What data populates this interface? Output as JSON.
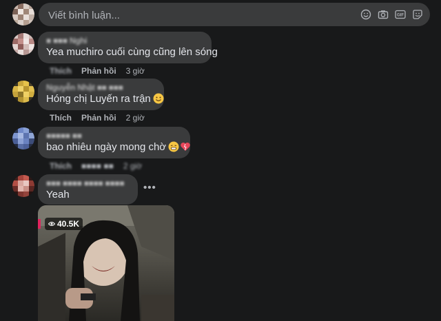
{
  "composer": {
    "placeholder": "Viết bình luận...",
    "icons": [
      "emoji-icon",
      "camera-icon",
      "gif-icon",
      "sticker-icon"
    ]
  },
  "comments": [
    {
      "author": "■ ■■■ Nghi",
      "text": "Yea muchiro cuối cùng cũng lên sóng",
      "like": "Thích",
      "reply": "Phản hồi",
      "time": "3 giờ"
    },
    {
      "author": "Nguyễn Nhật ■■ ■■■",
      "text": "Hóng chị Luyến ra trận",
      "emoji": "smiling-face-emoji",
      "like": "Thích",
      "reply": "Phản hồi",
      "time": "2 giờ"
    },
    {
      "author": "■■■■■ ■■",
      "text": "bao nhiêu ngày mong chờ",
      "emoji": [
        "grinning-face-emoji",
        "heart-emoji"
      ],
      "like": "Thích",
      "reply": "■■■■ ■■",
      "time": "2 giờ"
    },
    {
      "author": "■■■ ■■■■ ■■■■ ■■■■",
      "text": "Yeah",
      "more": "•••",
      "video": {
        "views": "40.5K"
      }
    }
  ],
  "colors": {
    "background": "#18191a",
    "bubble": "#3a3b3c",
    "text": "#e4e6eb",
    "muted": "#b0b3b8"
  }
}
